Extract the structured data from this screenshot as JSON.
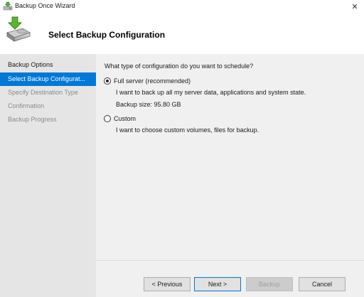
{
  "window": {
    "title": "Backup Once Wizard",
    "close_glyph": "✕"
  },
  "header": {
    "title": "Select Backup Configuration",
    "icon": "backup-wizard-icon"
  },
  "sidebar": {
    "items": [
      {
        "label": "Backup Options",
        "state": "completed"
      },
      {
        "label": "Select Backup Configurat...",
        "state": "active"
      },
      {
        "label": "Specify Destination Type",
        "state": "pending"
      },
      {
        "label": "Confirmation",
        "state": "pending"
      },
      {
        "label": "Backup Progress",
        "state": "pending"
      }
    ]
  },
  "main": {
    "question": "What type of configuration do you want to schedule?",
    "options": [
      {
        "label": "Full server (recommended)",
        "description": "I want to back up all my server data, applications and system state.",
        "extra": "Backup size: 95.80 GB",
        "selected": true
      },
      {
        "label": "Custom",
        "description": "I want to choose custom volumes, files for backup.",
        "selected": false
      }
    ]
  },
  "buttons": {
    "previous": "< Previous",
    "next": "Next >",
    "backup": "Backup",
    "cancel": "Cancel"
  },
  "colors": {
    "accent": "#0078d7",
    "sidebar_bg": "#e5e5e5",
    "content_bg": "#f0f0f0"
  }
}
